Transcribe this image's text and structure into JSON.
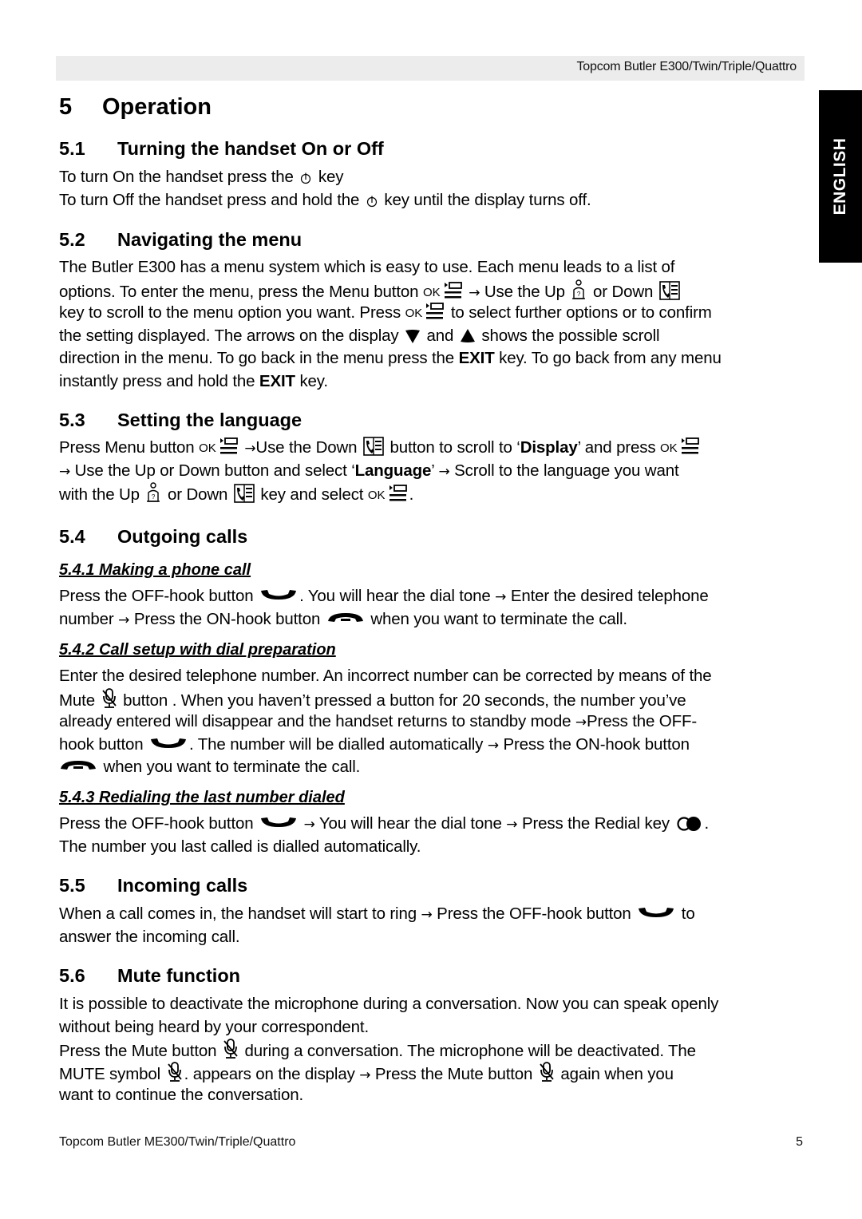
{
  "header": {
    "title": "Topcom Butler E300/Twin/Triple/Quattro"
  },
  "side_tab": {
    "label": "ENGLISH"
  },
  "chapter": {
    "number": "5",
    "title": "Operation"
  },
  "sections": {
    "s51": {
      "number": "5.1",
      "title": "Turning the handset On or Off",
      "l1a": "To turn On the handset press the",
      "l1b": "key",
      "l2a": "To turn Off the handset press and hold the",
      "l2b": "key until the display turns off."
    },
    "s52": {
      "number": "5.2",
      "title": "Navigating the menu",
      "l1": "The Butler E300 has a menu system which is easy to use.  Each menu leads to a list of",
      "l2a": "options. To enter the menu, press the Menu button",
      "l2b": "Use the Up",
      "l2c": "or Down",
      "l3a": "key to scroll to the menu option you want.  Press",
      "l3b": "to select further options or to confirm",
      "l4a": "the setting displayed. The arrows on the display",
      "l4b": "and",
      "l4c": "shows the possible scroll",
      "l5a": "direction in the menu. To go back in the menu press the",
      "l5b": "EXIT",
      "l5c": "key.  To go back from any menu",
      "l6a": "instantly press and hold the",
      "l6b": "EXIT",
      "l6c": "key."
    },
    "s53": {
      "number": "5.3",
      "title": "Setting the language",
      "l1a": "Press Menu button",
      "l1b": "Use the Down",
      "l1c": "button to scroll to ‘",
      "l1d": "Display",
      "l1e": "’ and press",
      "l2a": "Use the Up or Down button and select ‘",
      "l2b": "Language",
      "l2c": "’",
      "l2d": "Scroll to the language you want",
      "l3a": "with the Up",
      "l3b": "or Down",
      "l3c": "key and select",
      "l3d": "."
    },
    "s54": {
      "number": "5.4",
      "title": "Outgoing calls",
      "sub1": {
        "title": "5.4.1 Making a phone call",
        "l1a": "Press the OFF-hook button",
        "l1b": ". You will hear the dial tone",
        "l1c": "Enter the desired telephone",
        "l2a": "number",
        "l2b": "Press the ON-hook button",
        "l2c": "when you want to terminate the call."
      },
      "sub2": {
        "title": "5.4.2 Call setup with dial preparation",
        "l1": "Enter the desired telephone number. An incorrect number can be corrected by means of the",
        "l2a": "Mute",
        "l2b": "button . When you haven’t pressed a button for 20 seconds, the number you’ve",
        "l3a": "already entered will disappear and the handset returns to standby mode",
        "l3b": "Press the OFF-",
        "l4a": "hook button",
        "l4b": ". The number will be dialled automatically",
        "l4c": "Press the ON-hook button",
        "l5": "when you want to terminate the call."
      },
      "sub3": {
        "title": "5.4.3 Redialing the last number dialed",
        "l1a": "Press the OFF-hook button",
        "l1b": "You will hear the dial tone",
        "l1c": "Press the Redial key",
        "l1d": ".",
        "l2": "The number you last called is dialled automatically."
      }
    },
    "s55": {
      "number": "5.5",
      "title": "Incoming calls",
      "l1a": "When a call comes in, the handset will start to ring",
      "l1b": "Press the OFF-hook button",
      "l1c": "to",
      "l2": "answer the incoming call."
    },
    "s56": {
      "number": "5.6",
      "title": "Mute function",
      "l1": "It is possible to deactivate the microphone during a conversation. Now you can speak openly",
      "l2": "without being heard by your correspondent.",
      "l3a": "Press the Mute button",
      "l3b": "during a conversation. The microphone will be deactivated. The",
      "l4a": "MUTE symbol",
      "l4b": ". appears on the display",
      "l4c": "Press the Mute button",
      "l4d": "again when you",
      "l5": "want to continue the conversation."
    }
  },
  "glyphs": {
    "arrow": "→",
    "ok": "OK"
  },
  "footer": {
    "left": "Topcom Butler ME300/Twin/Triple/Quattro",
    "page_number": "5"
  }
}
